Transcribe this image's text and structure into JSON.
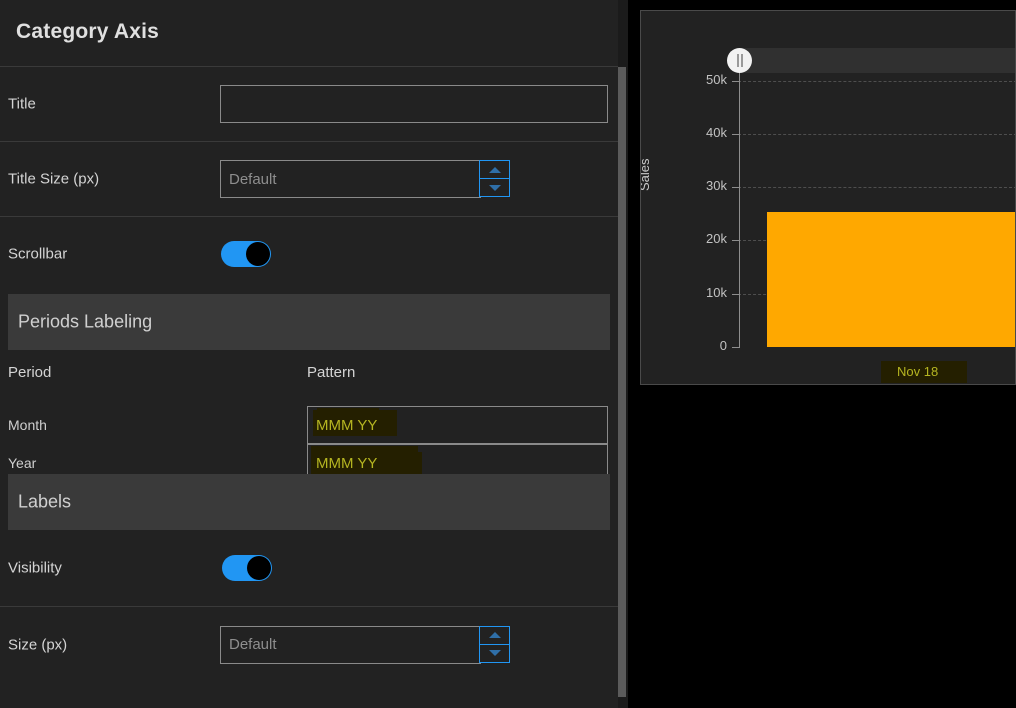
{
  "panel": {
    "title": "Category Axis",
    "rows": [
      {
        "label": "Title",
        "type": "text",
        "value": "",
        "placeholder": ""
      },
      {
        "label": "Title Size (px)",
        "type": "number",
        "value": "",
        "placeholder": "Default"
      },
      {
        "label": "Scrollbar",
        "type": "toggle",
        "state": "on"
      }
    ],
    "periods_section": {
      "band_title": "Periods Labeling",
      "columns": {
        "period": "Period",
        "pattern": "Pattern"
      },
      "rows": [
        {
          "period": "Month",
          "pattern": "MMM YY"
        },
        {
          "period": "Year",
          "pattern": "MMM YY"
        }
      ]
    },
    "labels_section": {
      "band_title": "Labels",
      "rows": [
        {
          "label": "Visibility",
          "type": "toggle",
          "state": "on"
        },
        {
          "label": "Size (px)",
          "type": "number",
          "value": "",
          "placeholder": "Default"
        }
      ]
    },
    "stepper": {
      "up_icon": "triangle-up-icon",
      "down_icon": "triangle-down-icon"
    },
    "scrollbar": {
      "icon": "vertical-scrollbar"
    }
  },
  "chart_data": {
    "type": "bar",
    "title": "",
    "xlabel": "",
    "ylabel": "Sales",
    "categories": [
      "Nov 18"
    ],
    "values": [
      25300
    ],
    "series": [
      {
        "name": "Sales",
        "values": [
          25300
        ],
        "color": "#ffa800"
      }
    ],
    "ylim": [
      0,
      52000
    ],
    "y_ticks": [
      0,
      10000,
      20000,
      30000,
      40000,
      50000
    ],
    "y_tick_labels": [
      "0",
      "10k",
      "20k",
      "30k",
      "40k",
      "50k"
    ],
    "grid": true,
    "legend": "none",
    "bar_color": "#ffa800",
    "category_label_color": "#b5b521",
    "scrollbar_grip": "category-axis-scrollbar-grip"
  },
  "colors": {
    "accent": "#2196f3",
    "bar": "#ffa800",
    "highlight_text": "#b5b521",
    "highlight_bg": "#241f00",
    "panel_bg": "#222222",
    "band_bg": "#3a3a3a"
  }
}
